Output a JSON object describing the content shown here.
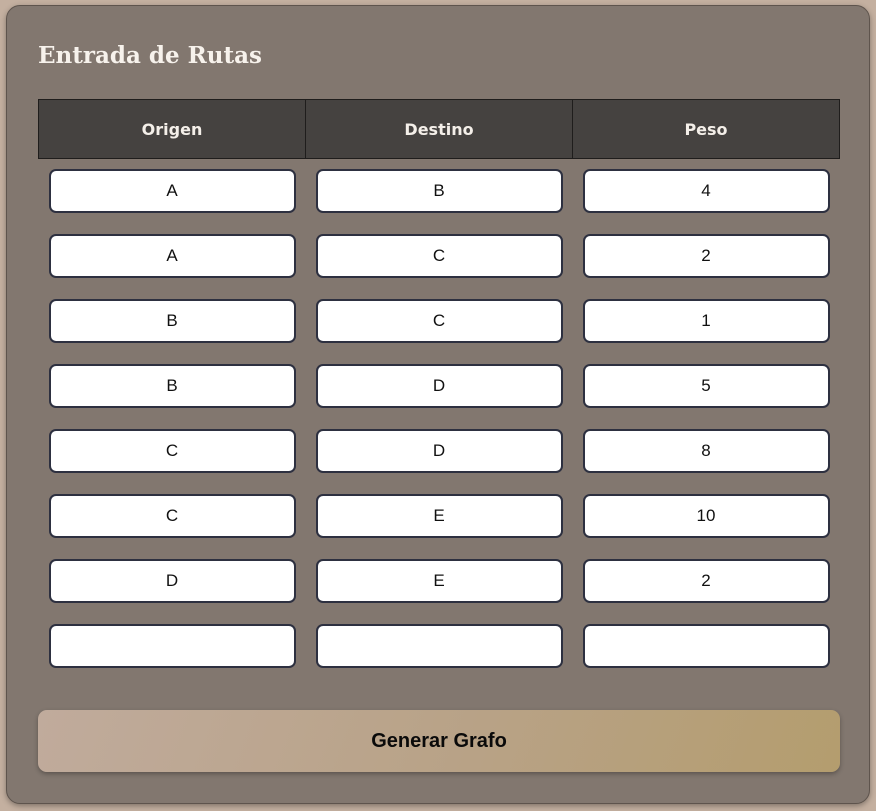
{
  "title": "Entrada de Rutas",
  "table": {
    "headers": [
      "Origen",
      "Destino",
      "Peso"
    ],
    "rows": [
      [
        "A",
        "B",
        "4"
      ],
      [
        "A",
        "C",
        "2"
      ],
      [
        "B",
        "C",
        "1"
      ],
      [
        "B",
        "D",
        "5"
      ],
      [
        "C",
        "D",
        "8"
      ],
      [
        "C",
        "E",
        "10"
      ],
      [
        "D",
        "E",
        "2"
      ],
      [
        "",
        "",
        ""
      ]
    ]
  },
  "button": {
    "label": "Generar Grafo"
  }
}
